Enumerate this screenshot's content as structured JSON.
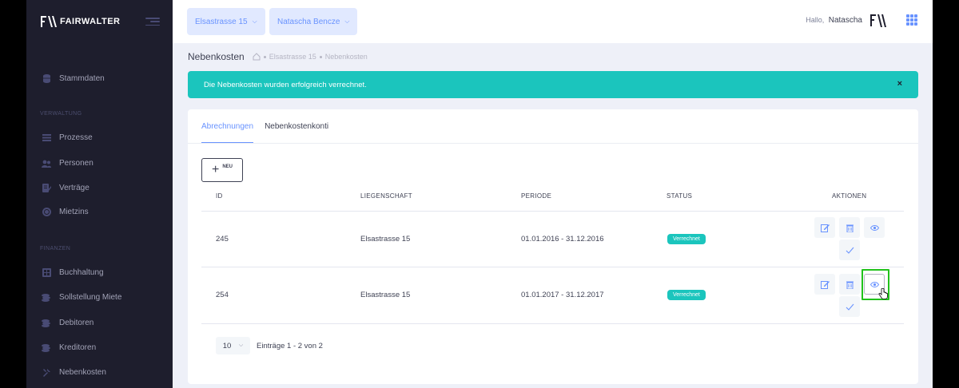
{
  "brand": {
    "name": "FAIRWALTER"
  },
  "sidebar": {
    "items": [
      {
        "label": "Stammdaten",
        "icon": "database-icon"
      },
      {
        "label": "Prozesse",
        "icon": "list-icon"
      },
      {
        "label": "Personen",
        "icon": "users-icon"
      },
      {
        "label": "Verträge",
        "icon": "contract-icon"
      },
      {
        "label": "Mietzins",
        "icon": "coin-icon"
      },
      {
        "label": "Buchhaltung",
        "icon": "ledger-icon"
      },
      {
        "label": "Sollstellung Miete",
        "icon": "coins-icon"
      },
      {
        "label": "Debitoren",
        "icon": "coins-icon"
      },
      {
        "label": "Kreditoren",
        "icon": "coins-icon"
      },
      {
        "label": "Nebenkosten",
        "icon": "tools-icon"
      }
    ],
    "sections": {
      "verwaltung": "VERWALTUNG",
      "finanzen": "FINANZEN"
    }
  },
  "topbar": {
    "property_select": "Elsastrasse 15",
    "person_select": "Natascha Bencze",
    "greeting": "Hallo,",
    "user_name": "Natascha"
  },
  "subheader": {
    "title": "Nebenkosten",
    "breadcrumb": [
      "Elsastrasse 15",
      "Nebenkosten"
    ]
  },
  "alert": {
    "message": "Die Nebenkosten wurden erfolgreich verrechnet.",
    "close": "×"
  },
  "tabs": [
    {
      "label": "Abrechnungen",
      "active": true
    },
    {
      "label": "Nebenkostenkonti",
      "active": false
    }
  ],
  "toolbar": {
    "new_label": "NEU"
  },
  "table": {
    "headers": {
      "id": "ID",
      "property": "LIEGENSCHAFT",
      "period": "PERIODE",
      "status": "STATUS",
      "actions": "AKTIONEN"
    },
    "rows": [
      {
        "id": "245",
        "property": "Elsastrasse 15",
        "period": "01.01.2016 - 31.12.2016",
        "status": "Verrechnet"
      },
      {
        "id": "254",
        "property": "Elsastrasse 15",
        "period": "01.01.2017 - 31.12.2017",
        "status": "Verrechnet"
      }
    ]
  },
  "pager": {
    "page_size": "10",
    "info": "Einträge 1 - 2 von 2"
  },
  "colors": {
    "accent": "#6993ff",
    "success": "#1bc5bd",
    "sidebar": "#1e1e2d",
    "highlight": "#21c21b"
  }
}
